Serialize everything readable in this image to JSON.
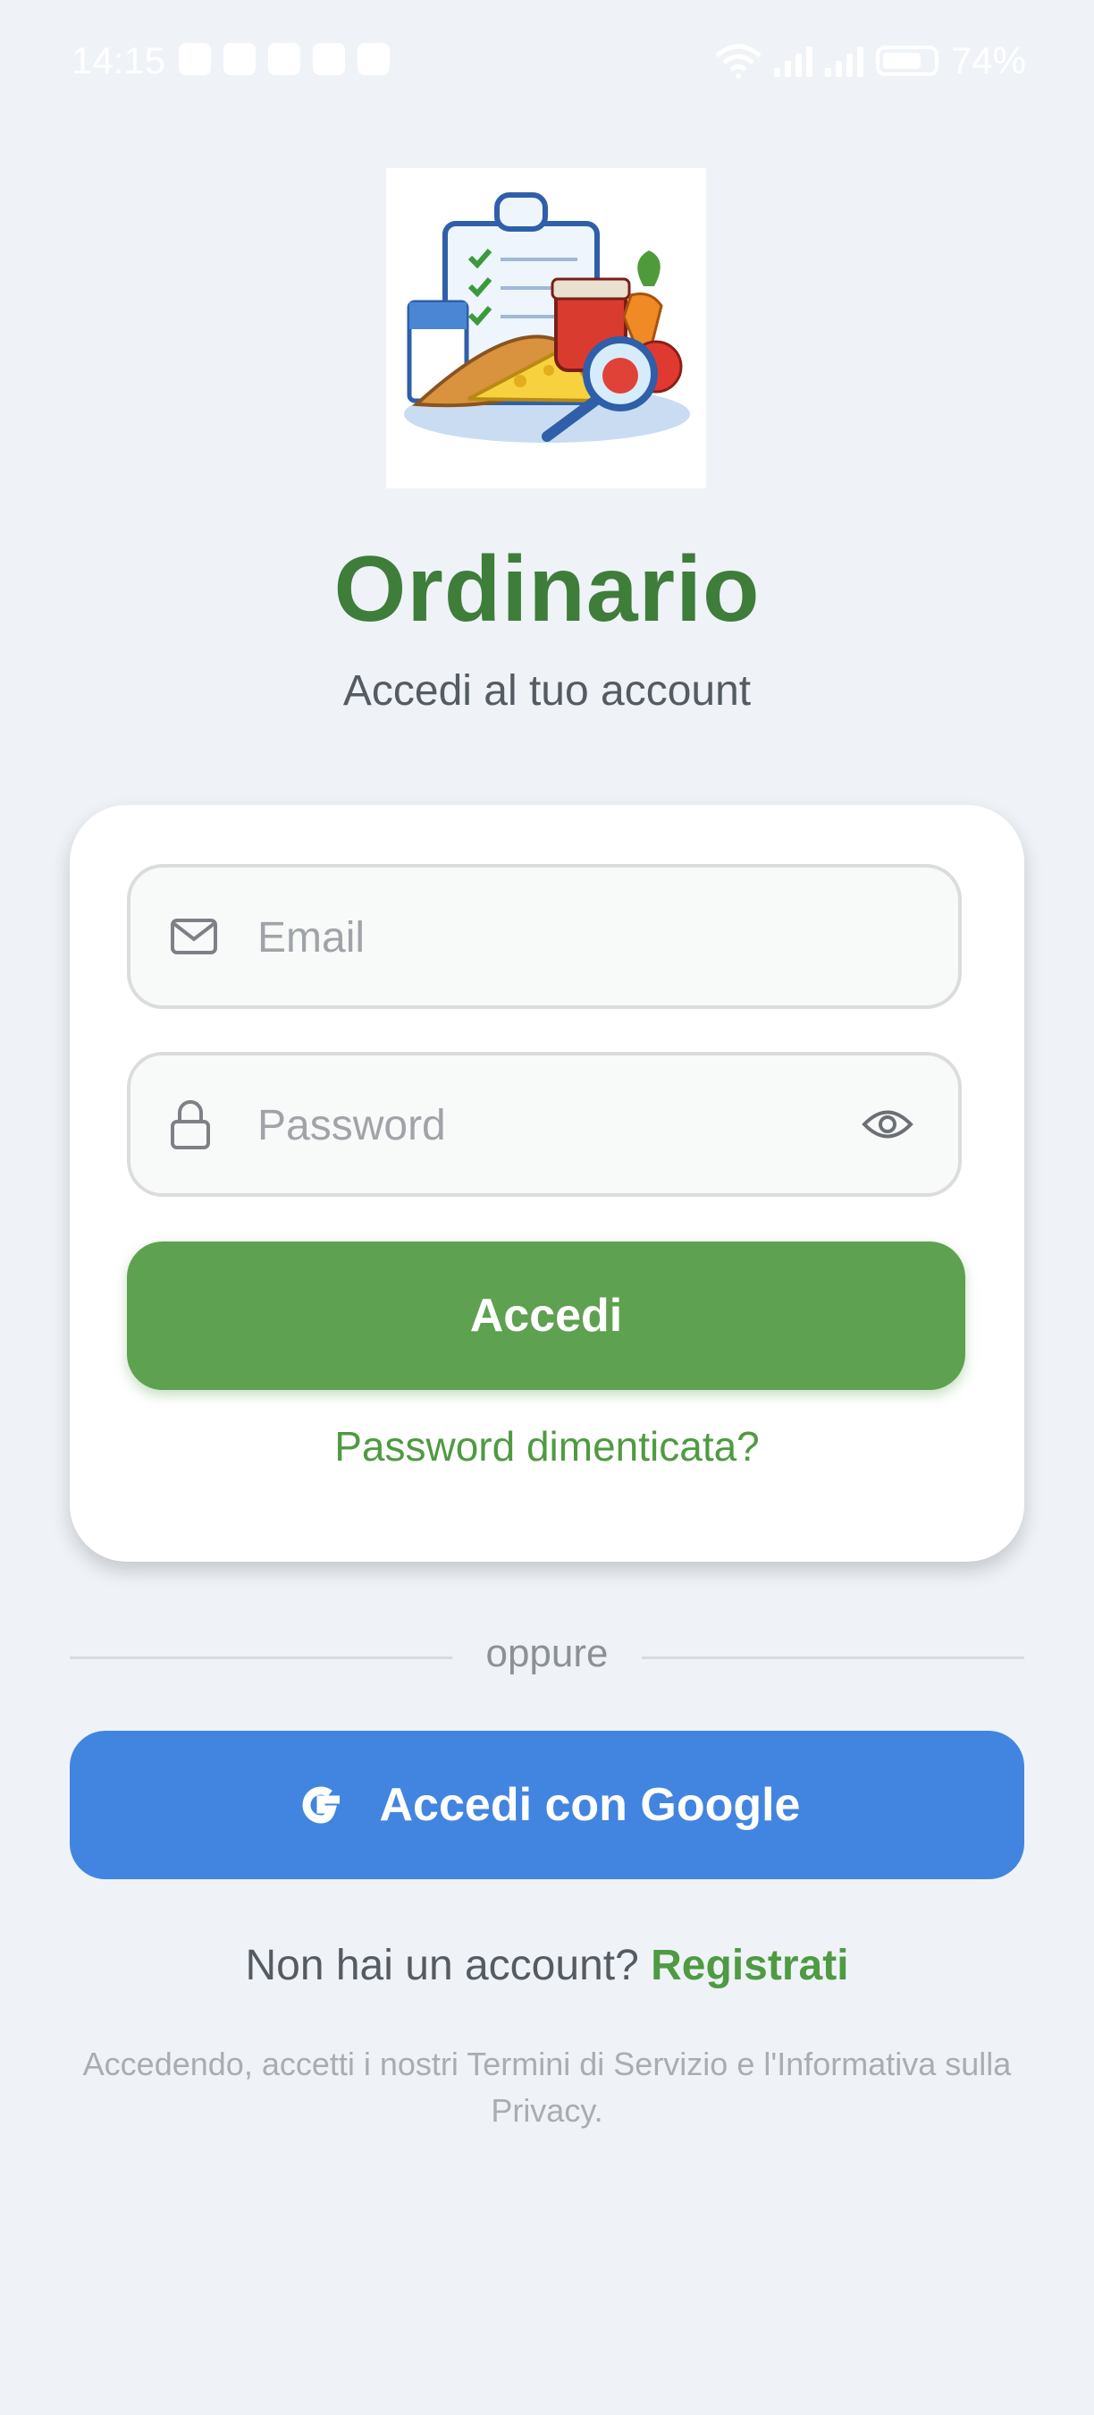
{
  "status_bar": {
    "time": "14:15",
    "battery": "74%"
  },
  "header": {
    "title": "Ordinario",
    "subtitle": "Accedi al tuo account"
  },
  "form": {
    "email_placeholder": "Email",
    "password_placeholder": "Password",
    "submit_label": "Accedi",
    "forgot_label": "Password dimenticata?"
  },
  "divider": {
    "label": "oppure"
  },
  "google": {
    "label": "Accedi con Google"
  },
  "register": {
    "prompt": "Non hai un account?",
    "link": "Registrati"
  },
  "legal": {
    "text": "Accedendo, accetti i nostri Termini di Servizio e l'Informativa sulla Privacy."
  },
  "icons": [
    "alarm-icon",
    "vibrate-icon",
    "wifi-icon",
    "signal-icon",
    "battery-icon",
    "mail-icon",
    "lock-icon",
    "eye-icon",
    "google-icon"
  ],
  "colors": {
    "brand_green": "#3f7d3a",
    "button_green": "#5ea150",
    "google_blue": "#4285e0",
    "background": "#eff3f8"
  }
}
